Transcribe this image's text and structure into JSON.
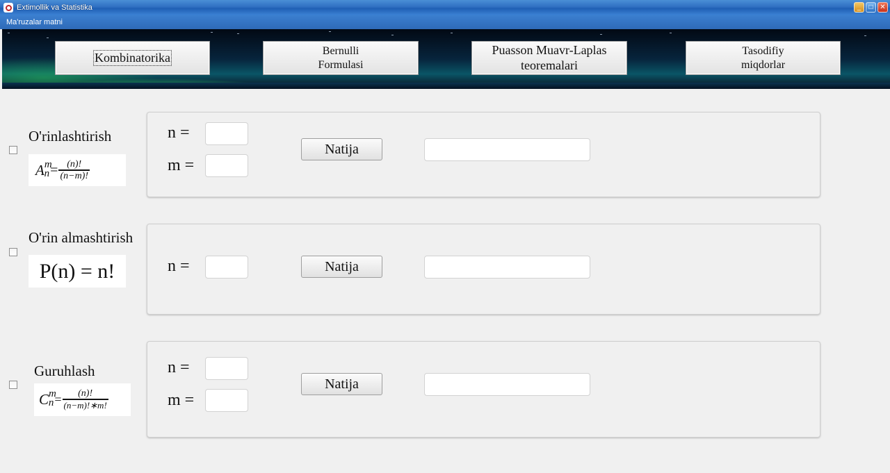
{
  "window": {
    "title": "Extimollik va Statistika",
    "controls": {
      "minimize": "_",
      "maximize": "□",
      "close": "✕"
    }
  },
  "menu": {
    "item": "Ma'ruzalar matni"
  },
  "nav": {
    "kombinatorika": "Kombinatorika",
    "bernulli_line1": "Bernulli",
    "bernulli_line2": "Formulasi",
    "puasson_line1": "Puasson Muavr-Laplas",
    "puasson_line2": "teoremalari",
    "tasodifiy_line1": "Tasodifiy",
    "tasodifiy_line2": "miqdorlar"
  },
  "sections": {
    "orinlashtirish": {
      "label": "O'rinlashtirish",
      "formula": {
        "symbol": "A",
        "sup": "m",
        "sub": "n",
        "eq": "=",
        "numerator": "(n)!",
        "denominator": "(n−m)!"
      },
      "n_label": "n =",
      "m_label": "m =",
      "button": "Natija"
    },
    "orin_almashtirish": {
      "label": "O'rin almashtirish",
      "formula": "P(n) = n!",
      "n_label": "n =",
      "button": "Natija"
    },
    "guruhlash": {
      "label": "Guruhlash",
      "formula": {
        "symbol": "C",
        "sup": "m",
        "sub": "n",
        "eq": "=",
        "numerator": "(n)!",
        "denominator": "(n−m)!∗m!"
      },
      "n_label": "n =",
      "m_label": "m =",
      "button": "Natija"
    }
  },
  "colors": {
    "titlebar": "#2f6fc2",
    "panel_bg": "#f0f0f0",
    "button_face": "#ececec"
  }
}
